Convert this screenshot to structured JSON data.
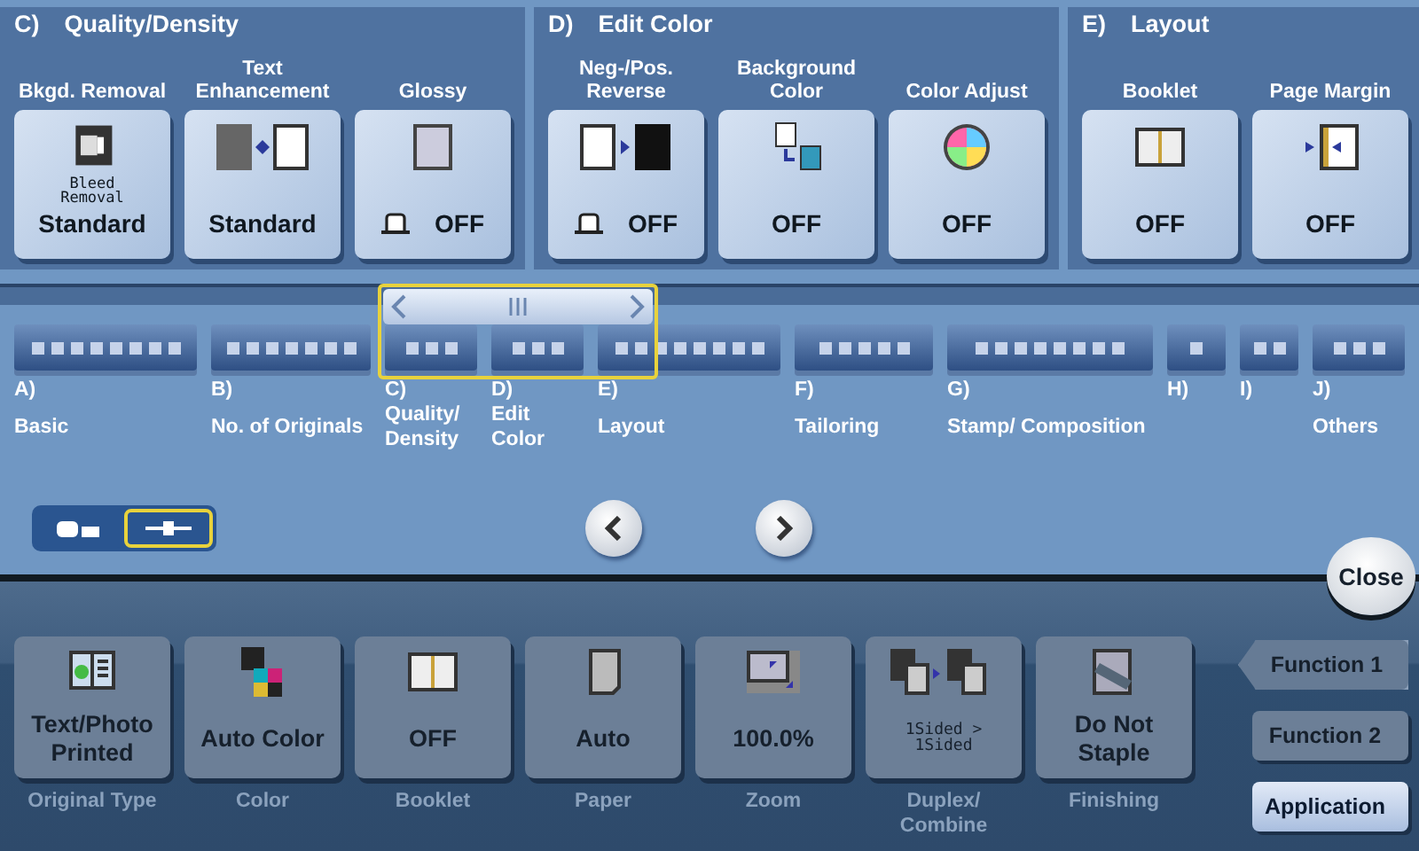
{
  "groups": [
    {
      "letter": "C)",
      "title": "Quality/Density",
      "buttons": [
        {
          "label": "Bkgd. Removal",
          "sub": "Bleed Removal",
          "value": "Standard",
          "kind": "plain"
        },
        {
          "label": "Text Enhancement",
          "value": "Standard",
          "kind": "plain"
        },
        {
          "label": "Glossy",
          "value": "OFF",
          "kind": "toggle"
        }
      ]
    },
    {
      "letter": "D)",
      "title": "Edit Color",
      "buttons": [
        {
          "label": "Neg-/Pos. Reverse",
          "value": "OFF",
          "kind": "toggle"
        },
        {
          "label": "Background Color",
          "value": "OFF",
          "kind": "plain"
        },
        {
          "label": "Color Adjust",
          "value": "OFF",
          "kind": "plain"
        }
      ]
    },
    {
      "letter": "E)",
      "title": "Layout",
      "buttons": [
        {
          "label": "Booklet",
          "value": "OFF",
          "kind": "plain"
        },
        {
          "label": "Page Margin",
          "value": "OFF",
          "kind": "plain"
        }
      ]
    }
  ],
  "map": {
    "categories": [
      {
        "letter": "A)",
        "label": "Basic"
      },
      {
        "letter": "B)",
        "label": "No. of Originals"
      },
      {
        "letter": "C)",
        "label": "Quality/ Density"
      },
      {
        "letter": "D)",
        "label": "Edit Color"
      },
      {
        "letter": "E)",
        "label": "Layout"
      },
      {
        "letter": "F)",
        "label": "Tailoring"
      },
      {
        "letter": "G)",
        "label": "Stamp/ Composition"
      },
      {
        "letter": "H)"
      },
      {
        "letter": "I)"
      },
      {
        "letter": "J)",
        "label": "Others"
      }
    ],
    "view_modes": [
      {
        "kind": "list",
        "selected": false
      },
      {
        "kind": "map",
        "selected": true
      }
    ]
  },
  "close": "Close",
  "settings": [
    {
      "value": "Text/Photo Printed",
      "caption": "Original Type",
      "kind": "text"
    },
    {
      "value": "Auto Color",
      "caption": "Color",
      "kind": "text"
    },
    {
      "value": "OFF",
      "caption": "Booklet",
      "kind": "text"
    },
    {
      "value": "Auto",
      "caption": "Paper",
      "kind": "text"
    },
    {
      "value": "100.0%",
      "caption": "Zoom",
      "kind": "text"
    },
    {
      "value": "1Sided > 1Sided",
      "caption": "Duplex/ Combine",
      "kind": "mono"
    },
    {
      "value": "Do Not Staple",
      "caption": "Finishing",
      "kind": "text"
    }
  ],
  "side_tabs": [
    {
      "label": "Function 1",
      "selected": true,
      "kind": "tab"
    },
    {
      "label": "Function 2",
      "selected": false,
      "kind": "tab"
    },
    {
      "label": "Application",
      "selected": false,
      "kind": "highlight"
    }
  ]
}
